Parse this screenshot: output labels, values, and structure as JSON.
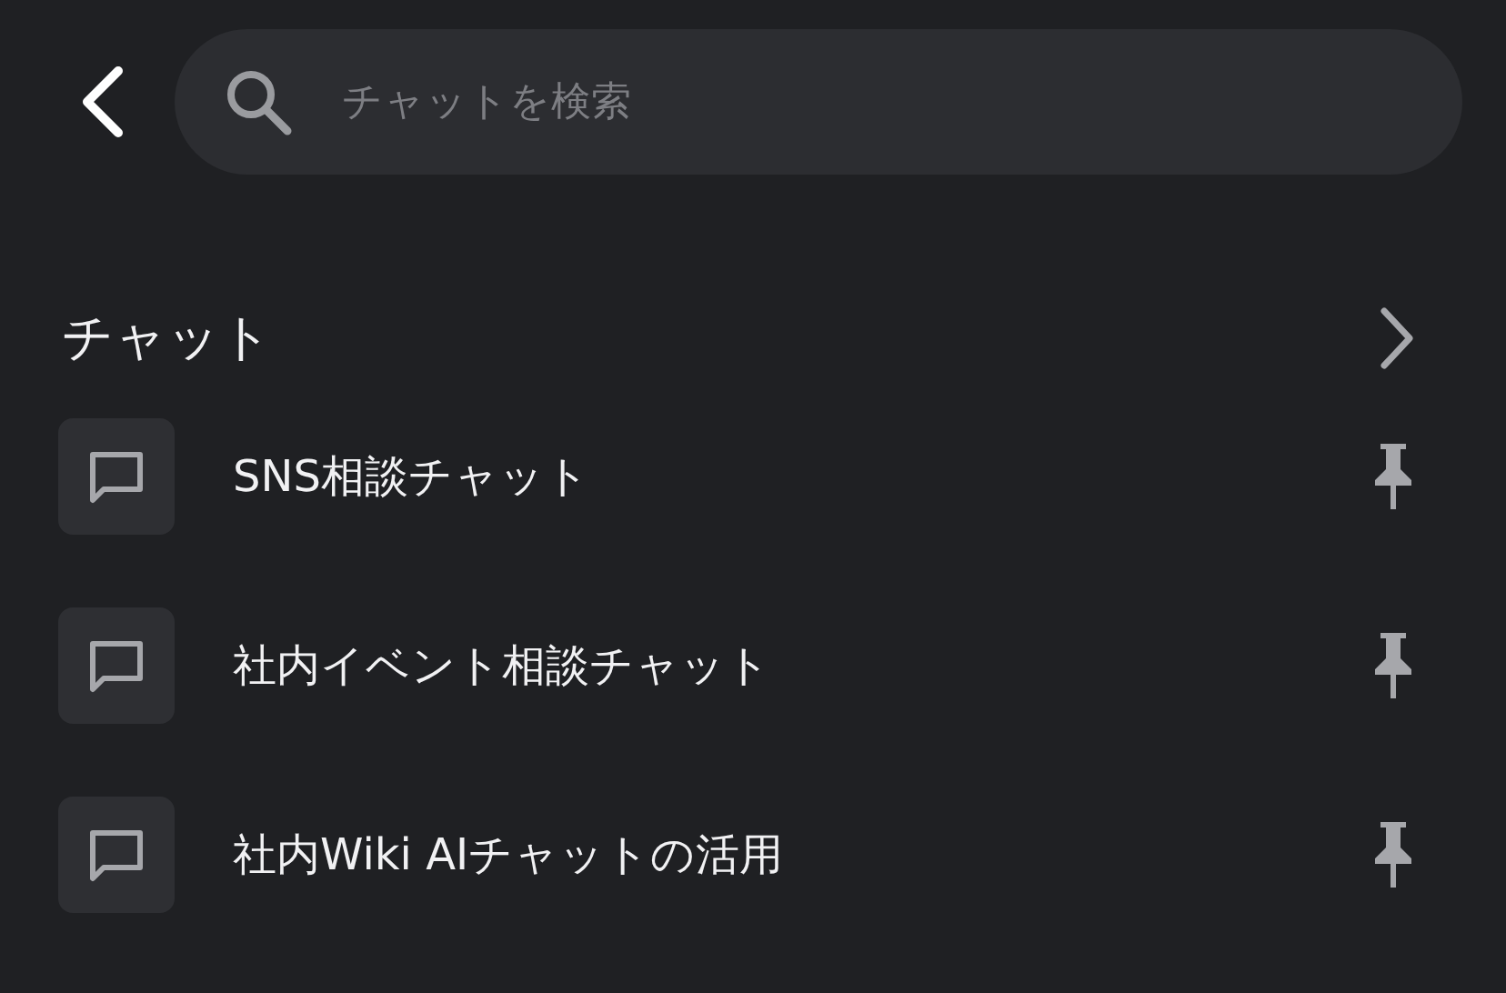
{
  "search": {
    "placeholder": "チャットを検索"
  },
  "section": {
    "title": "チャット"
  },
  "chats": [
    {
      "title": "SNS相談チャット",
      "pinned": true
    },
    {
      "title": "社内イベント相談チャット",
      "pinned": true
    },
    {
      "title": "社内Wiki AIチャットの活用",
      "pinned": true
    }
  ]
}
